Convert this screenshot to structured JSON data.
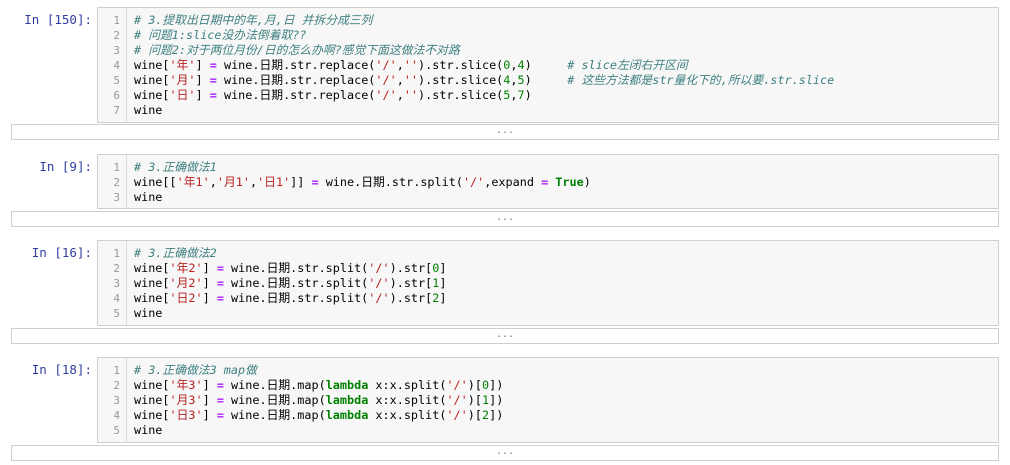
{
  "cells": [
    {
      "prompt": "In  [150]:",
      "lines": [
        {
          "n": "1",
          "segments": [
            {
              "t": "# 3.提取出日期中的年,月,日 并拆分成三列",
              "c": "cm"
            }
          ]
        },
        {
          "n": "2",
          "segments": [
            {
              "t": "# 问题1:slice没办法倒着取??",
              "c": "cm"
            }
          ]
        },
        {
          "n": "3",
          "segments": [
            {
              "t": "# 问题2:对于两位月份/日的怎么办啊?感觉下面这做法不对路",
              "c": "cm"
            }
          ]
        },
        {
          "n": "4",
          "segments": [
            {
              "t": "wine[",
              "c": ""
            },
            {
              "t": "'年'",
              "c": "st"
            },
            {
              "t": "] ",
              "c": ""
            },
            {
              "t": "=",
              "c": "op"
            },
            {
              "t": " wine.日期.str.replace(",
              "c": ""
            },
            {
              "t": "'/'",
              "c": "st"
            },
            {
              "t": ",",
              "c": ""
            },
            {
              "t": "''",
              "c": "st"
            },
            {
              "t": ").str.slice(",
              "c": ""
            },
            {
              "t": "0",
              "c": "nm"
            },
            {
              "t": ",",
              "c": ""
            },
            {
              "t": "4",
              "c": "nm"
            },
            {
              "t": ")     ",
              "c": ""
            },
            {
              "t": "# slice左闭右开区间",
              "c": "cm"
            }
          ]
        },
        {
          "n": "5",
          "segments": [
            {
              "t": "wine[",
              "c": ""
            },
            {
              "t": "'月'",
              "c": "st"
            },
            {
              "t": "] ",
              "c": ""
            },
            {
              "t": "=",
              "c": "op"
            },
            {
              "t": " wine.日期.str.replace(",
              "c": ""
            },
            {
              "t": "'/'",
              "c": "st"
            },
            {
              "t": ",",
              "c": ""
            },
            {
              "t": "''",
              "c": "st"
            },
            {
              "t": ").str.slice(",
              "c": ""
            },
            {
              "t": "4",
              "c": "nm"
            },
            {
              "t": ",",
              "c": ""
            },
            {
              "t": "5",
              "c": "nm"
            },
            {
              "t": ")     ",
              "c": ""
            },
            {
              "t": "# 这些方法都是str量化下的,所以要.str.slice",
              "c": "cm"
            }
          ]
        },
        {
          "n": "6",
          "segments": [
            {
              "t": "wine[",
              "c": ""
            },
            {
              "t": "'日'",
              "c": "st"
            },
            {
              "t": "] ",
              "c": ""
            },
            {
              "t": "=",
              "c": "op"
            },
            {
              "t": " wine.日期.str.replace(",
              "c": ""
            },
            {
              "t": "'/'",
              "c": "st"
            },
            {
              "t": ",",
              "c": ""
            },
            {
              "t": "''",
              "c": "st"
            },
            {
              "t": ").str.slice(",
              "c": ""
            },
            {
              "t": "5",
              "c": "nm"
            },
            {
              "t": ",",
              "c": ""
            },
            {
              "t": "7",
              "c": "nm"
            },
            {
              "t": ")",
              "c": ""
            }
          ]
        },
        {
          "n": "7",
          "segments": [
            {
              "t": "wine",
              "c": ""
            }
          ]
        }
      ],
      "output": "..."
    },
    {
      "prompt": "In  [9]:",
      "lines": [
        {
          "n": "1",
          "segments": [
            {
              "t": "# 3.正确做法1",
              "c": "cm"
            }
          ]
        },
        {
          "n": "2",
          "segments": [
            {
              "t": "wine[[",
              "c": ""
            },
            {
              "t": "'年1'",
              "c": "st"
            },
            {
              "t": ",",
              "c": ""
            },
            {
              "t": "'月1'",
              "c": "st"
            },
            {
              "t": ",",
              "c": ""
            },
            {
              "t": "'日1'",
              "c": "st"
            },
            {
              "t": "]] ",
              "c": ""
            },
            {
              "t": "=",
              "c": "op"
            },
            {
              "t": " wine.日期.str.split(",
              "c": ""
            },
            {
              "t": "'/'",
              "c": "st"
            },
            {
              "t": ",expand ",
              "c": ""
            },
            {
              "t": "=",
              "c": "op"
            },
            {
              "t": " ",
              "c": ""
            },
            {
              "t": "True",
              "c": "kw"
            },
            {
              "t": ")",
              "c": ""
            }
          ]
        },
        {
          "n": "3",
          "segments": [
            {
              "t": "wine",
              "c": ""
            }
          ]
        }
      ],
      "output": "..."
    },
    {
      "prompt": "In  [16]:",
      "lines": [
        {
          "n": "1",
          "segments": [
            {
              "t": "# 3.正确做法2",
              "c": "cm"
            }
          ]
        },
        {
          "n": "2",
          "segments": [
            {
              "t": "wine[",
              "c": ""
            },
            {
              "t": "'年2'",
              "c": "st"
            },
            {
              "t": "] ",
              "c": ""
            },
            {
              "t": "=",
              "c": "op"
            },
            {
              "t": " wine.日期.str.split(",
              "c": ""
            },
            {
              "t": "'/'",
              "c": "st"
            },
            {
              "t": ").str[",
              "c": ""
            },
            {
              "t": "0",
              "c": "nm"
            },
            {
              "t": "]",
              "c": ""
            }
          ]
        },
        {
          "n": "3",
          "segments": [
            {
              "t": "wine[",
              "c": ""
            },
            {
              "t": "'月2'",
              "c": "st"
            },
            {
              "t": "] ",
              "c": ""
            },
            {
              "t": "=",
              "c": "op"
            },
            {
              "t": " wine.日期.str.split(",
              "c": ""
            },
            {
              "t": "'/'",
              "c": "st"
            },
            {
              "t": ").str[",
              "c": ""
            },
            {
              "t": "1",
              "c": "nm"
            },
            {
              "t": "]",
              "c": ""
            }
          ]
        },
        {
          "n": "4",
          "segments": [
            {
              "t": "wine[",
              "c": ""
            },
            {
              "t": "'日2'",
              "c": "st"
            },
            {
              "t": "] ",
              "c": ""
            },
            {
              "t": "=",
              "c": "op"
            },
            {
              "t": " wine.日期.str.split(",
              "c": ""
            },
            {
              "t": "'/'",
              "c": "st"
            },
            {
              "t": ").str[",
              "c": ""
            },
            {
              "t": "2",
              "c": "nm"
            },
            {
              "t": "]",
              "c": ""
            }
          ]
        },
        {
          "n": "5",
          "segments": [
            {
              "t": "wine",
              "c": ""
            }
          ]
        }
      ],
      "output": "..."
    },
    {
      "prompt": "In  [18]:",
      "lines": [
        {
          "n": "1",
          "segments": [
            {
              "t": "# 3.正确做法3 map做",
              "c": "cm"
            }
          ]
        },
        {
          "n": "2",
          "segments": [
            {
              "t": "wine[",
              "c": ""
            },
            {
              "t": "'年3'",
              "c": "st"
            },
            {
              "t": "] ",
              "c": ""
            },
            {
              "t": "=",
              "c": "op"
            },
            {
              "t": " wine.日期.map(",
              "c": ""
            },
            {
              "t": "lambda",
              "c": "kw"
            },
            {
              "t": " x:x.split(",
              "c": ""
            },
            {
              "t": "'/'",
              "c": "st"
            },
            {
              "t": ")[",
              "c": ""
            },
            {
              "t": "0",
              "c": "nm"
            },
            {
              "t": "])",
              "c": ""
            }
          ]
        },
        {
          "n": "3",
          "segments": [
            {
              "t": "wine[",
              "c": ""
            },
            {
              "t": "'月3'",
              "c": "st"
            },
            {
              "t": "] ",
              "c": ""
            },
            {
              "t": "=",
              "c": "op"
            },
            {
              "t": " wine.日期.map(",
              "c": ""
            },
            {
              "t": "lambda",
              "c": "kw"
            },
            {
              "t": " x:x.split(",
              "c": ""
            },
            {
              "t": "'/'",
              "c": "st"
            },
            {
              "t": ")[",
              "c": ""
            },
            {
              "t": "1",
              "c": "nm"
            },
            {
              "t": "])",
              "c": ""
            }
          ]
        },
        {
          "n": "4",
          "segments": [
            {
              "t": "wine[",
              "c": ""
            },
            {
              "t": "'日3'",
              "c": "st"
            },
            {
              "t": "] ",
              "c": ""
            },
            {
              "t": "=",
              "c": "op"
            },
            {
              "t": " wine.日期.map(",
              "c": ""
            },
            {
              "t": "lambda",
              "c": "kw"
            },
            {
              "t": " x:x.split(",
              "c": ""
            },
            {
              "t": "'/'",
              "c": "st"
            },
            {
              "t": ")[",
              "c": ""
            },
            {
              "t": "2",
              "c": "nm"
            },
            {
              "t": "])",
              "c": ""
            }
          ]
        },
        {
          "n": "5",
          "segments": [
            {
              "t": "wine",
              "c": ""
            }
          ]
        }
      ],
      "output": "..."
    }
  ]
}
